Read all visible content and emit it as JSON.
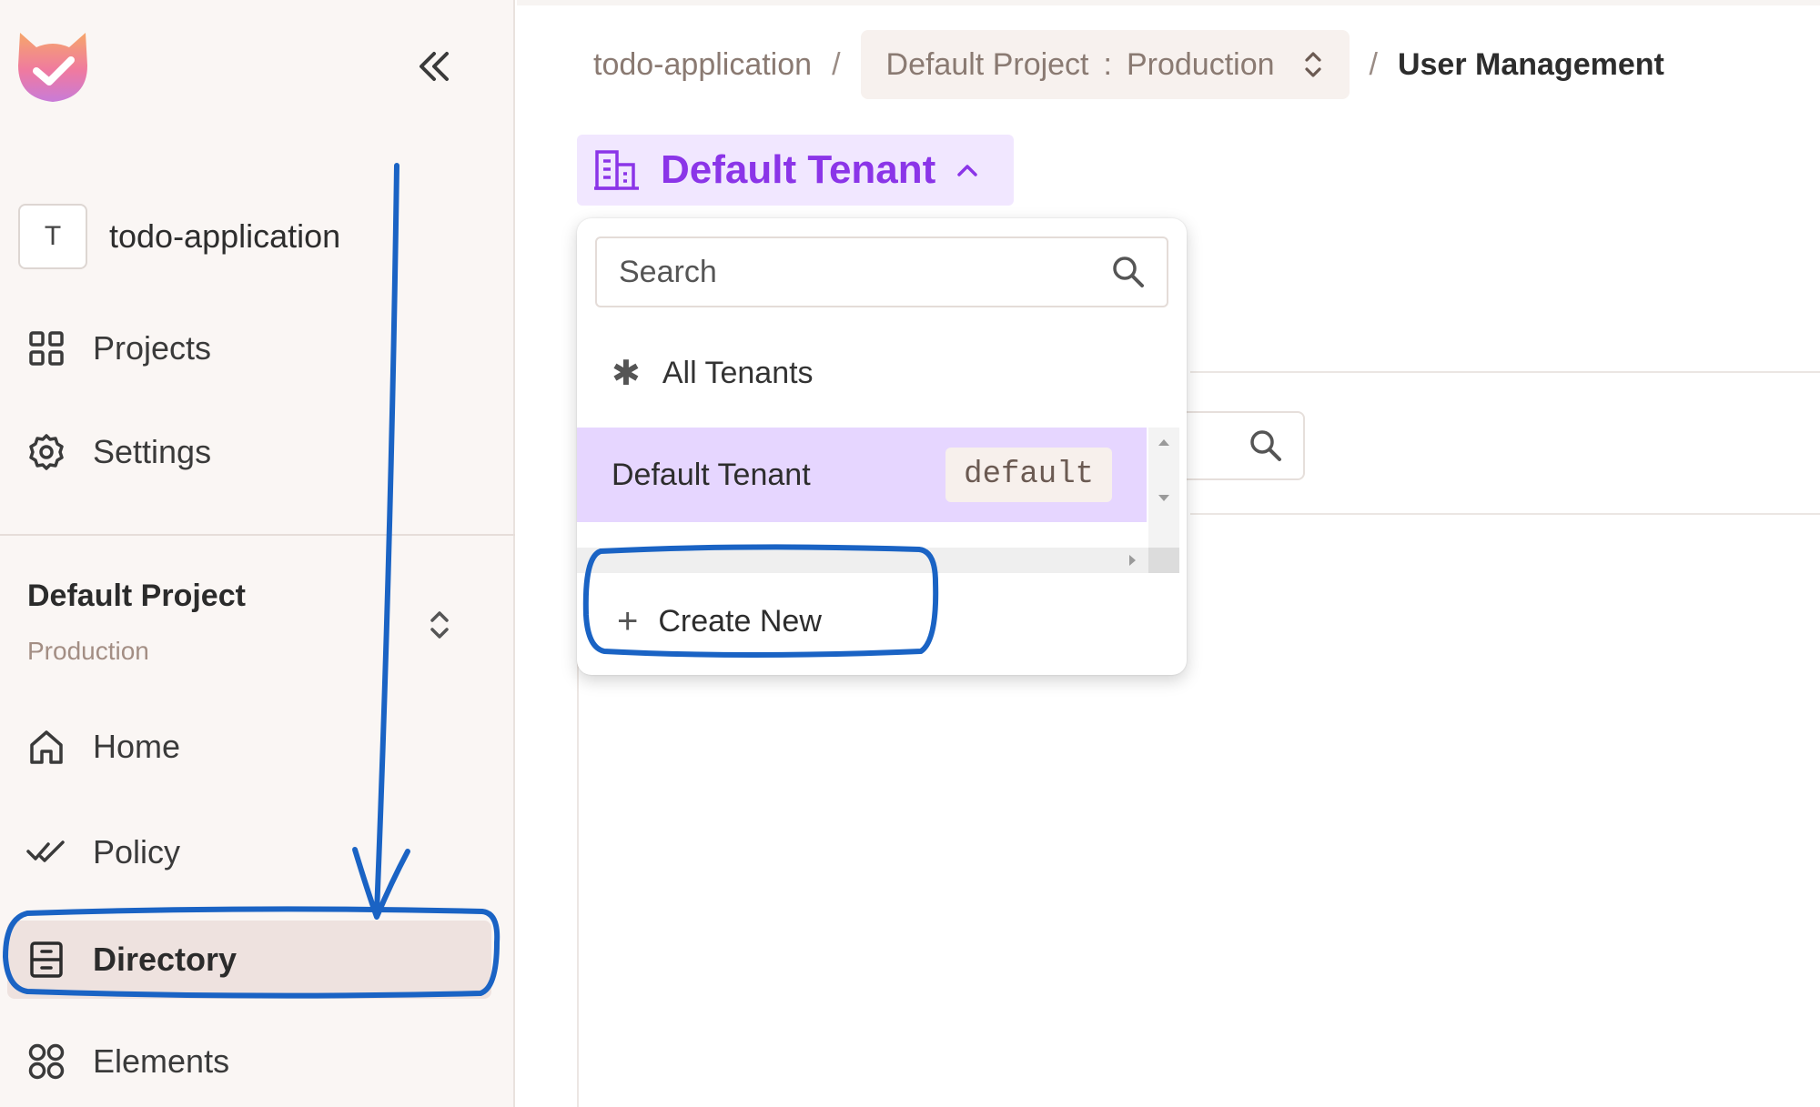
{
  "sidebar": {
    "org": {
      "avatar_letter": "T",
      "name": "todo-application"
    },
    "top_items": [
      {
        "label": "Projects",
        "icon": "grid-icon"
      },
      {
        "label": "Settings",
        "icon": "gear-icon"
      }
    ],
    "project": {
      "name": "Default Project",
      "environment": "Production"
    },
    "items": [
      {
        "label": "Home",
        "icon": "home-icon"
      },
      {
        "label": "Policy",
        "icon": "double-check-icon"
      },
      {
        "label": "Directory",
        "icon": "directory-icon",
        "active": true
      },
      {
        "label": "Elements",
        "icon": "elements-icon"
      }
    ]
  },
  "breadcrumb": {
    "org": "todo-application",
    "separator": "/",
    "project": "Default Project",
    "colon": ":",
    "environment": "Production",
    "current": "User Management"
  },
  "tenant_selector": {
    "label": "Default Tenant",
    "accent_color": "#8b35e8"
  },
  "dropdown": {
    "search_placeholder": "Search",
    "all_label": "All Tenants",
    "options": [
      {
        "label": "Default Tenant",
        "key": "default",
        "selected": true
      }
    ],
    "create_label": "Create New"
  },
  "annotation_color": "#1a63c4"
}
